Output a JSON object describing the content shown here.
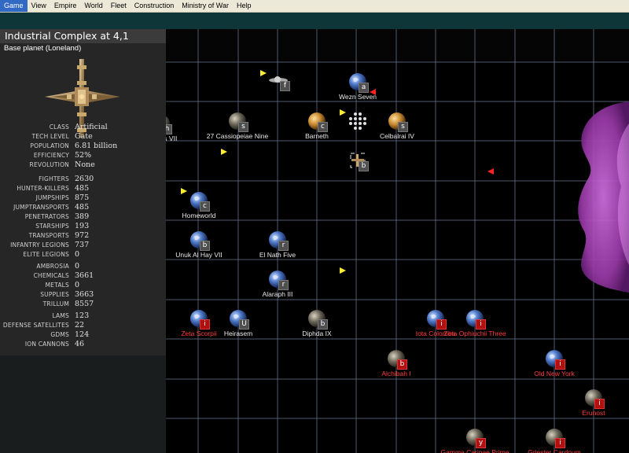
{
  "menu": [
    "Game",
    "View",
    "Empire",
    "World",
    "Fleet",
    "Construction",
    "Ministry of War",
    "Help"
  ],
  "panel": {
    "title": "Industrial Complex at 4,1",
    "subtitle": "Base planet (Loneland)",
    "stats_group1": [
      {
        "label": "CLASS",
        "value": "Artificial"
      },
      {
        "label": "TECH LEVEL",
        "value": "Gate"
      },
      {
        "label": "POPULATION",
        "value": "6.81 billion"
      },
      {
        "label": "EFFICIENCY",
        "value": "52%"
      },
      {
        "label": "REVOLUTION",
        "value": "None"
      }
    ],
    "stats_group2": [
      {
        "label": "FIGHTERS",
        "value": "2630"
      },
      {
        "label": "HUNTER-KILLERS",
        "value": "485"
      },
      {
        "label": "JUMPSHIPS",
        "value": "875"
      },
      {
        "label": "JUMPTRANSPORTS",
        "value": "485"
      },
      {
        "label": "PENETRATORS",
        "value": "389"
      },
      {
        "label": "STARSHIPS",
        "value": "193"
      },
      {
        "label": "TRANSPORTS",
        "value": "972"
      },
      {
        "label": "INFANTRY LEGIONS",
        "value": "737"
      },
      {
        "label": "ELITE LEGIONS",
        "value": "0"
      }
    ],
    "stats_group3": [
      {
        "label": "AMBROSIA",
        "value": "0"
      },
      {
        "label": "CHEMICALS",
        "value": "3661"
      },
      {
        "label": "METALS",
        "value": "0"
      },
      {
        "label": "SUPPLIES",
        "value": "3663"
      },
      {
        "label": "TRILLUM",
        "value": "8557"
      }
    ],
    "stats_group4": [
      {
        "label": "LAMS",
        "value": "123"
      },
      {
        "label": "DEFENSE SATELLITES",
        "value": "22"
      },
      {
        "label": "GDMS",
        "value": "124"
      },
      {
        "label": "ION CANNONS",
        "value": "46"
      }
    ]
  },
  "colors": {
    "grid": "#6a7590",
    "label_white": "#e8e8e8",
    "label_red": "#ff3c3c",
    "nebula": "#a040b0",
    "fleet_yellow": "#ffee33",
    "fleet_red": "#ff2222"
  },
  "worlds": [
    {
      "name": "Wezn Seven",
      "badge": "a",
      "color": "white",
      "kind": "earth"
    },
    {
      "name": "",
      "badge": "f",
      "color": "white",
      "kind": "station"
    },
    {
      "name": "Leporis VII",
      "badge": "h",
      "color": "white",
      "kind": "hidden"
    },
    {
      "name": "27 Cassiopeiae Nine",
      "badge": "s",
      "color": "white",
      "kind": "rock"
    },
    {
      "name": "Barneth",
      "badge": "c",
      "color": "white",
      "kind": "desert"
    },
    {
      "name": "",
      "badge": "",
      "color": "white",
      "kind": "cluster"
    },
    {
      "name": "Celbalrai IV",
      "badge": "s",
      "color": "white",
      "kind": "desert"
    },
    {
      "name": "",
      "badge": "b",
      "color": "white",
      "kind": "selected"
    },
    {
      "name": "Homeworld",
      "badge": "c",
      "color": "white",
      "kind": "earth"
    },
    {
      "name": "Unuk Al Hay VII",
      "badge": "b",
      "color": "white",
      "kind": "earth"
    },
    {
      "name": "El Nath Five",
      "badge": "r",
      "color": "white",
      "kind": "earth"
    },
    {
      "name": "Alaraph III",
      "badge": "r",
      "color": "white",
      "kind": "earth"
    },
    {
      "name": "Zeta Scorpii",
      "badge": "i",
      "color": "red",
      "kind": "earth"
    },
    {
      "name": "Heirasem",
      "badge": "U",
      "color": "white",
      "kind": "earth"
    },
    {
      "name": "Diphda IX",
      "badge": "b",
      "color": "white",
      "kind": "rock"
    },
    {
      "name": "Iota Colomba",
      "badge": "i",
      "color": "red",
      "kind": "earth"
    },
    {
      "name": "Zeta Ophiuchii Three",
      "badge": "i",
      "color": "red",
      "kind": "earth"
    },
    {
      "name": "Alchibah I",
      "badge": "b",
      "color": "red",
      "kind": "rock"
    },
    {
      "name": "Old New York",
      "badge": "i",
      "color": "red",
      "kind": "earth"
    },
    {
      "name": "Erunost",
      "badge": "i",
      "color": "red",
      "kind": "rock"
    },
    {
      "name": "Gamma Carinae Prime",
      "badge": "y",
      "color": "red",
      "kind": "rock"
    },
    {
      "name": "Griester Cardoum",
      "badge": "i",
      "color": "red",
      "kind": "rock"
    }
  ]
}
